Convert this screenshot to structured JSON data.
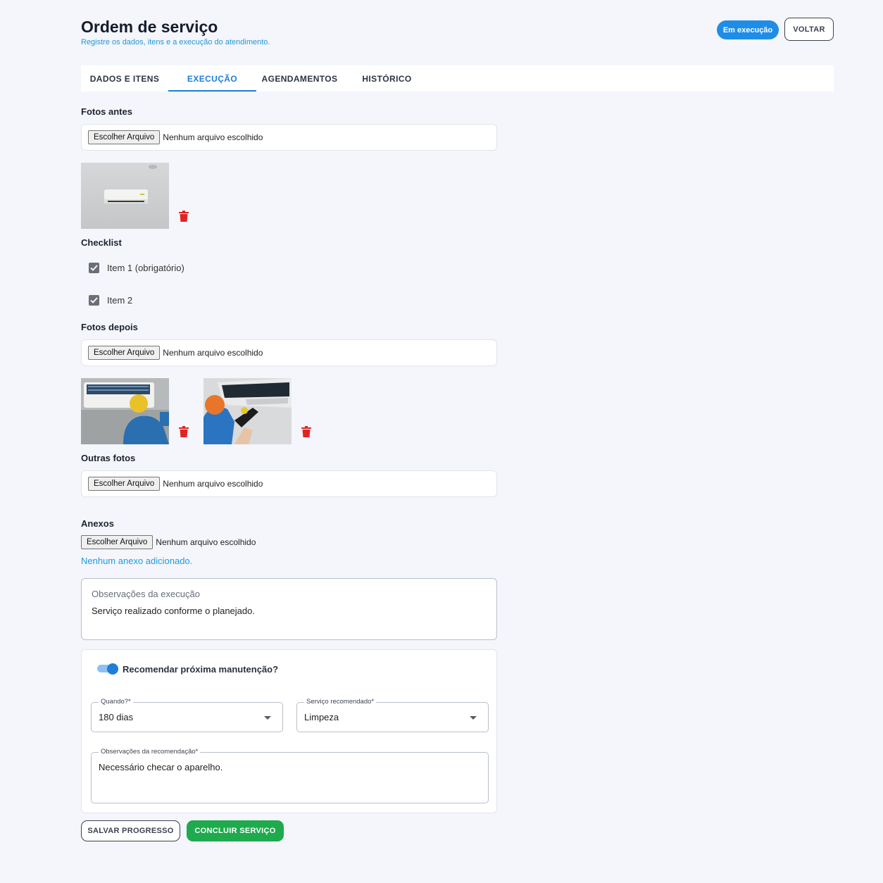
{
  "header": {
    "title": "Ordem de serviço",
    "subtitle": "Registre os dados, itens e a execução do atendimento.",
    "status_badge": "Em execução",
    "back_label": "VOLTAR"
  },
  "tabs": [
    {
      "label": "DADOS E ITENS",
      "active": false
    },
    {
      "label": "EXECUÇÃO",
      "active": true
    },
    {
      "label": "AGENDAMENTOS",
      "active": false
    },
    {
      "label": "HISTÓRICO",
      "active": false
    }
  ],
  "file_input": {
    "button_label": "Escolher Arquivo",
    "empty_text": "Nenhum arquivo escolhido"
  },
  "photos_before": {
    "label": "Fotos antes",
    "count": 1
  },
  "checklist": {
    "label": "Checklist",
    "items": [
      {
        "label": "Item 1 (obrigatório)",
        "checked": true
      },
      {
        "label": "Item 2",
        "checked": true
      }
    ]
  },
  "photos_after": {
    "label": "Fotos depois",
    "count": 2
  },
  "other_photos": {
    "label": "Outras fotos"
  },
  "attachments": {
    "label": "Anexos",
    "empty_message": "Nenhum anexo adicionado."
  },
  "execution_notes": {
    "label": "Observações da execução",
    "value": "Serviço realizado conforme o planejado."
  },
  "recommendation": {
    "toggle_label": "Recomendar próxima manutenção?",
    "enabled": true,
    "when": {
      "label": "Quando?*",
      "value": "180 dias"
    },
    "service": {
      "label": "Serviço recomendado*",
      "value": "Limpeza"
    },
    "notes": {
      "label": "Observações da recomendação*",
      "value": "Necessário checar o aparelho."
    }
  },
  "actions": {
    "save_label": "SALVAR PROGRESSO",
    "complete_label": "CONCLUIR SERVIÇO"
  },
  "colors": {
    "accent": "#1e7ed8",
    "success": "#1eaa4d",
    "danger": "#e02424",
    "link": "#1e9be0"
  }
}
